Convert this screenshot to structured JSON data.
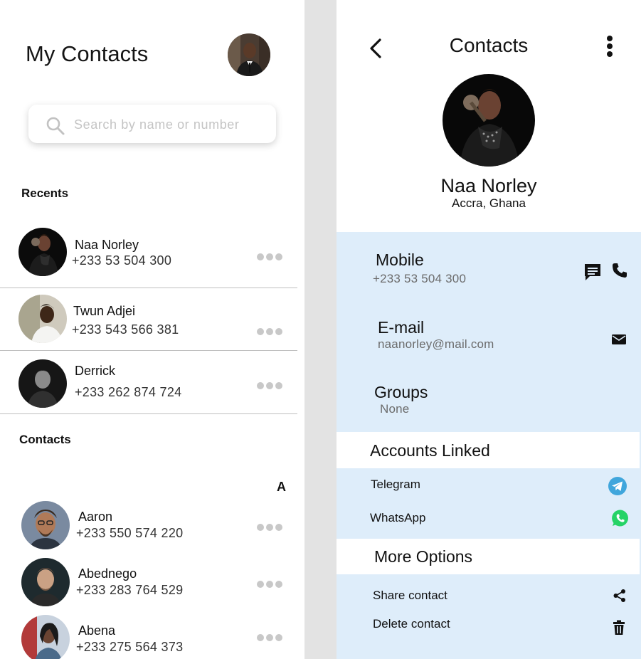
{
  "left": {
    "title": "My Contacts",
    "search": {
      "placeholder": "Search by name or number",
      "value": ""
    },
    "recents_label": "Recents",
    "recents": [
      {
        "name": "Naa Norley",
        "phone": "+233 53 504 300"
      },
      {
        "name": "Twun Adjei",
        "phone": "+233 543 566 381"
      },
      {
        "name": "Derrick",
        "phone": "+233 262 874 724"
      }
    ],
    "contacts_label": "Contacts",
    "index_letter": "A",
    "contacts": [
      {
        "name": "Aaron",
        "phone": "+233 550 574 220"
      },
      {
        "name": "Abednego",
        "phone": "+233 283 764 529"
      },
      {
        "name": "Abena",
        "phone": "+233 275 564 373"
      }
    ]
  },
  "right": {
    "title": "Contacts",
    "contact": {
      "name": "Naa Norley",
      "location": "Accra, Ghana"
    },
    "mobile": {
      "label": "Mobile",
      "value": "+233 53 504 300"
    },
    "email": {
      "label": "E-mail",
      "value": "naanorley@mail.com"
    },
    "groups": {
      "label": "Groups",
      "value": "None"
    },
    "accounts_linked": {
      "title": "Accounts Linked",
      "items": [
        {
          "label": "Telegram",
          "icon": "telegram-icon",
          "color": "#40a6dc"
        },
        {
          "label": "WhatsApp",
          "icon": "whatsapp-icon",
          "color": "#25d366"
        }
      ]
    },
    "more_options": {
      "title": "More Options",
      "items": [
        {
          "label": "Share contact",
          "icon": "share-icon"
        },
        {
          "label": "Delete contact",
          "icon": "trash-icon"
        }
      ]
    }
  },
  "colors": {
    "detail_panel_bg": "#deedfa",
    "divider_strip": "#e3e3e3",
    "more_dots": "#c8c8c8"
  }
}
